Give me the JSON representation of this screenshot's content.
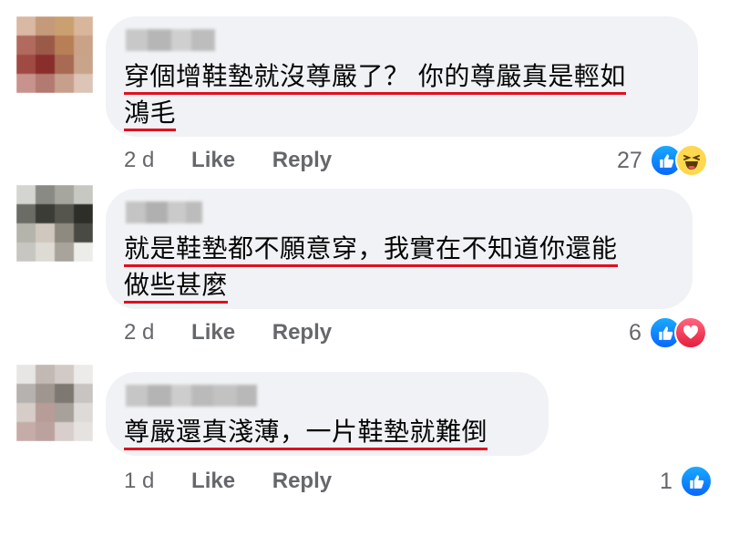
{
  "comments": [
    {
      "text_lines": [
        "穿個增鞋墊就沒尊嚴了？ 你的尊嚴真是輕如",
        "鴻毛"
      ],
      "age": "2 d",
      "like_label": "Like",
      "reply_label": "Reply",
      "reaction_count": "27",
      "reactions": [
        "like-icon",
        "haha-icon"
      ]
    },
    {
      "text_lines": [
        "就是鞋墊都不願意穿，我實在不知道你還能",
        "做些甚麼"
      ],
      "age": "2 d",
      "like_label": "Like",
      "reply_label": "Reply",
      "reaction_count": "6",
      "reactions": [
        "like-icon",
        "love-icon"
      ]
    },
    {
      "text_lines": [
        "尊嚴還真淺薄，一片鞋墊就難倒"
      ],
      "age": "1 d",
      "like_label": "Like",
      "reply_label": "Reply",
      "reaction_count": "1",
      "reactions": [
        "like-icon"
      ]
    }
  ],
  "colors": {
    "bubble": "#f0f2f5",
    "underline": "#e0101e",
    "meta_text": "#65676b",
    "like_blue": "#0866ff"
  }
}
